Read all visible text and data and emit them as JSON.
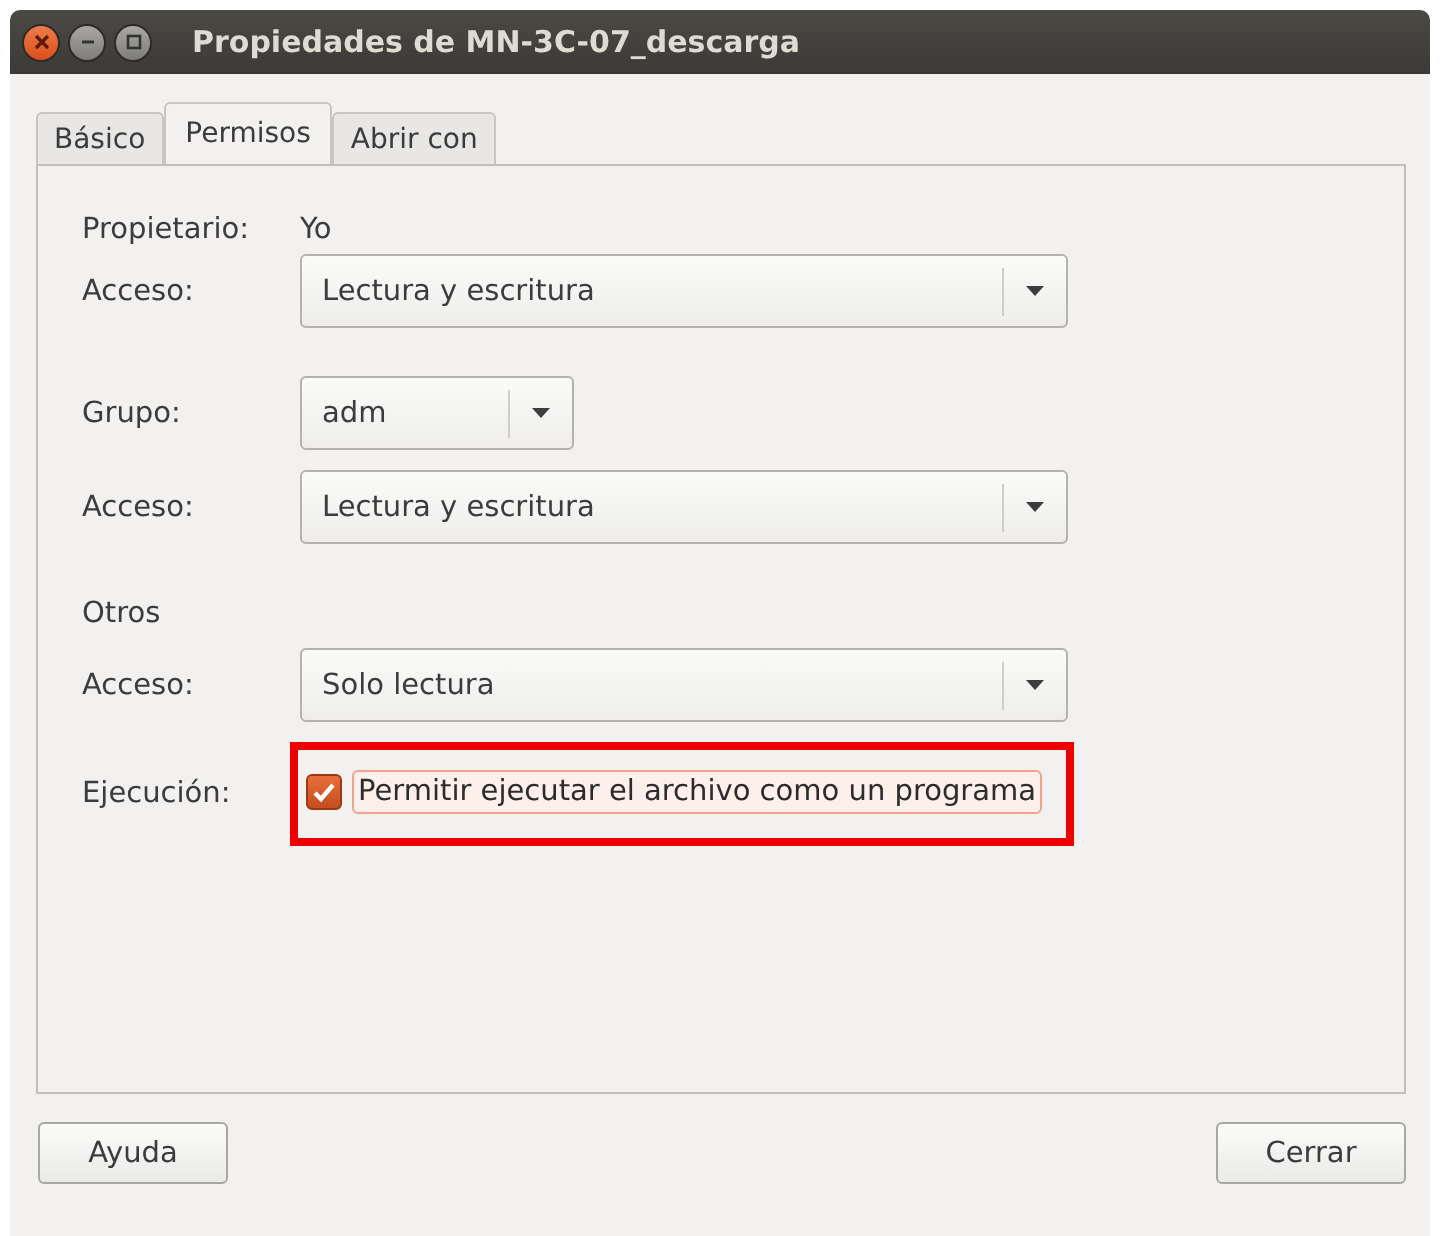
{
  "window": {
    "title": "Propiedades de MN-3C-07_descarga"
  },
  "tabs": [
    {
      "label": "Básico",
      "selected": false
    },
    {
      "label": "Permisos",
      "selected": true
    },
    {
      "label": "Abrir con",
      "selected": false
    }
  ],
  "sections": [
    {
      "rows": [
        {
          "kind": "value",
          "label": "Propietario:",
          "value": "Yo"
        },
        {
          "kind": "combo",
          "label": "Acceso:",
          "value": "Lectura y escritura",
          "wide": true
        }
      ]
    },
    {
      "rows": [
        {
          "kind": "combo",
          "label": "Grupo:",
          "value": "adm",
          "wide": false
        },
        {
          "kind": "combo",
          "label": "Acceso:",
          "value": "Lectura y escritura",
          "wide": true
        }
      ]
    },
    {
      "rows": [
        {
          "kind": "heading",
          "label": "Otros"
        },
        {
          "kind": "combo",
          "label": "Acceso:",
          "value": "Solo lectura",
          "wide": true
        },
        {
          "kind": "checkbox",
          "label": "Ejecución:",
          "value": "Permitir ejecutar el archivo como un programa",
          "checked": true,
          "highlighted": true
        }
      ]
    }
  ],
  "buttons": [
    "Ayuda",
    "Cerrar"
  ]
}
